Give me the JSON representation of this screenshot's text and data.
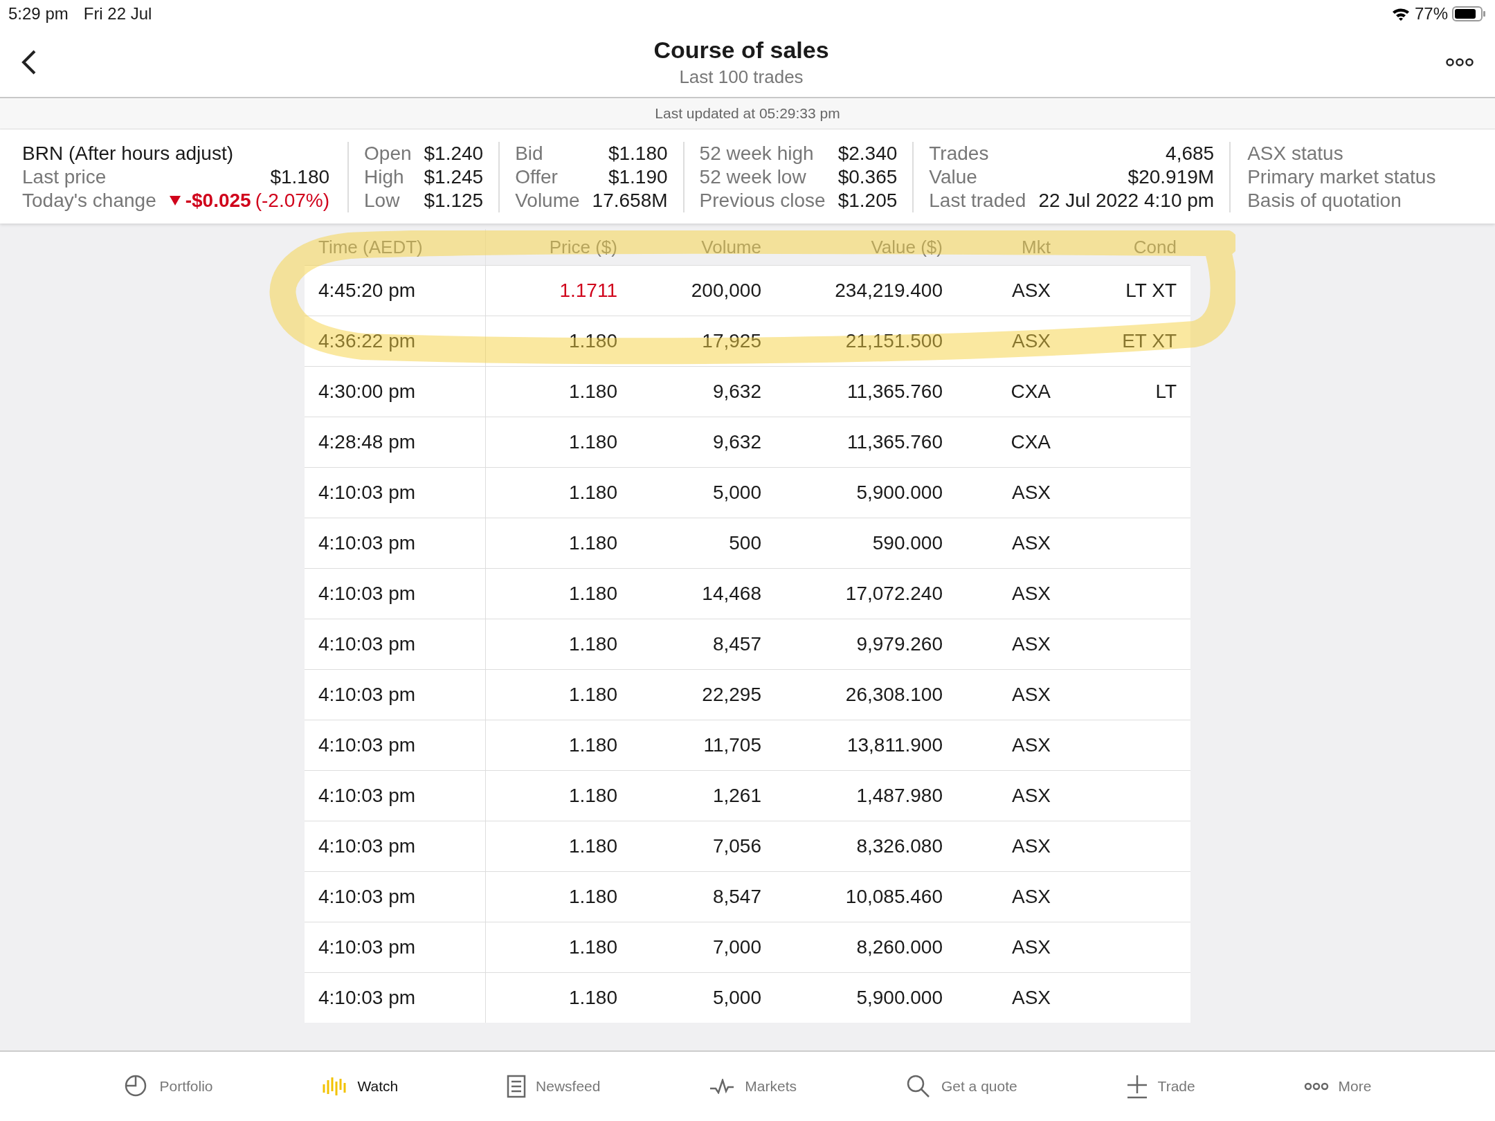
{
  "status_bar": {
    "time": "5:29 pm",
    "date": "Fri 22 Jul",
    "battery": "77%"
  },
  "header": {
    "title": "Course of sales",
    "subtitle": "Last 100 trades"
  },
  "last_updated": "Last updated at 05:29:33 pm",
  "summary": {
    "name": "BRN (After hours adjust)",
    "last_price_label": "Last price",
    "last_price": "$1.180",
    "change_label": "Today's change",
    "change": "-$0.025",
    "change_pct": "(-2.07%)",
    "change_down": true,
    "groups": [
      {
        "rows": [
          {
            "label": "Open",
            "value": "$1.240"
          },
          {
            "label": "High",
            "value": "$1.245"
          },
          {
            "label": "Low",
            "value": "$1.125"
          }
        ]
      },
      {
        "rows": [
          {
            "label": "Bid",
            "value": "$1.180"
          },
          {
            "label": "Offer",
            "value": "$1.190"
          },
          {
            "label": "Volume",
            "value": "17.658M"
          }
        ]
      },
      {
        "rows": [
          {
            "label": "52 week high",
            "value": "$2.340"
          },
          {
            "label": "52 week low",
            "value": "$0.365"
          },
          {
            "label": "Previous close",
            "value": "$1.205"
          }
        ]
      },
      {
        "rows": [
          {
            "label": "Trades",
            "value": "4,685"
          },
          {
            "label": "Value",
            "value": "$20.919M"
          },
          {
            "label": "Last traded",
            "value": "22 Jul 2022 4:10 pm"
          }
        ]
      }
    ],
    "status": [
      "ASX status",
      "Primary market status",
      "Basis of quotation"
    ]
  },
  "table": {
    "columns": [
      "Time (AEDT)",
      "Price ($)",
      "Volume",
      "Value ($)",
      "Mkt",
      "Cond"
    ],
    "rows": [
      {
        "time": "4:45:20 pm",
        "price": "1.1711",
        "price_down": true,
        "volume": "200,000",
        "value": "234,219.400",
        "mkt": "ASX",
        "cond": "LT XT"
      },
      {
        "time": "4:36:22 pm",
        "price": "1.180",
        "price_down": false,
        "volume": "17,925",
        "value": "21,151.500",
        "mkt": "ASX",
        "cond": "ET XT"
      },
      {
        "time": "4:30:00 pm",
        "price": "1.180",
        "price_down": false,
        "volume": "9,632",
        "value": "11,365.760",
        "mkt": "CXA",
        "cond": "LT"
      },
      {
        "time": "4:28:48 pm",
        "price": "1.180",
        "price_down": false,
        "volume": "9,632",
        "value": "11,365.760",
        "mkt": "CXA"
      },
      {
        "time": "4:10:03 pm",
        "price": "1.180",
        "price_down": false,
        "volume": "5,000",
        "value": "5,900.000",
        "mkt": "ASX"
      },
      {
        "time": "4:10:03 pm",
        "price": "1.180",
        "price_down": false,
        "volume": "500",
        "value": "590.000",
        "mkt": "ASX"
      },
      {
        "time": "4:10:03 pm",
        "price": "1.180",
        "price_down": false,
        "volume": "14,468",
        "value": "17,072.240",
        "mkt": "ASX"
      },
      {
        "time": "4:10:03 pm",
        "price": "1.180",
        "price_down": false,
        "volume": "8,457",
        "value": "9,979.260",
        "mkt": "ASX"
      },
      {
        "time": "4:10:03 pm",
        "price": "1.180",
        "price_down": false,
        "volume": "22,295",
        "value": "26,308.100",
        "mkt": "ASX"
      },
      {
        "time": "4:10:03 pm",
        "price": "1.180",
        "price_down": false,
        "volume": "11,705",
        "value": "13,811.900",
        "mkt": "ASX"
      },
      {
        "time": "4:10:03 pm",
        "price": "1.180",
        "price_down": false,
        "volume": "1,261",
        "value": "1,487.980",
        "mkt": "ASX"
      },
      {
        "time": "4:10:03 pm",
        "price": "1.180",
        "price_down": false,
        "volume": "7,056",
        "value": "8,326.080",
        "mkt": "ASX"
      },
      {
        "time": "4:10:03 pm",
        "price": "1.180",
        "price_down": false,
        "volume": "8,547",
        "value": "10,085.460",
        "mkt": "ASX"
      },
      {
        "time": "4:10:03 pm",
        "price": "1.180",
        "price_down": false,
        "volume": "7,000",
        "value": "8,260.000",
        "mkt": "ASX"
      },
      {
        "time": "4:10:03 pm",
        "price": "1.180",
        "price_down": false,
        "volume": "5,000",
        "value": "5,900.000",
        "mkt": "ASX"
      }
    ]
  },
  "tab_bar": [
    {
      "label": "Portfolio",
      "selected": false
    },
    {
      "label": "Watch",
      "selected": true
    },
    {
      "label": "Newsfeed",
      "selected": false
    },
    {
      "label": "Markets",
      "selected": false
    },
    {
      "label": "Get a quote",
      "selected": false
    },
    {
      "label": "Trade",
      "selected": false
    },
    {
      "label": "More",
      "selected": false
    }
  ]
}
